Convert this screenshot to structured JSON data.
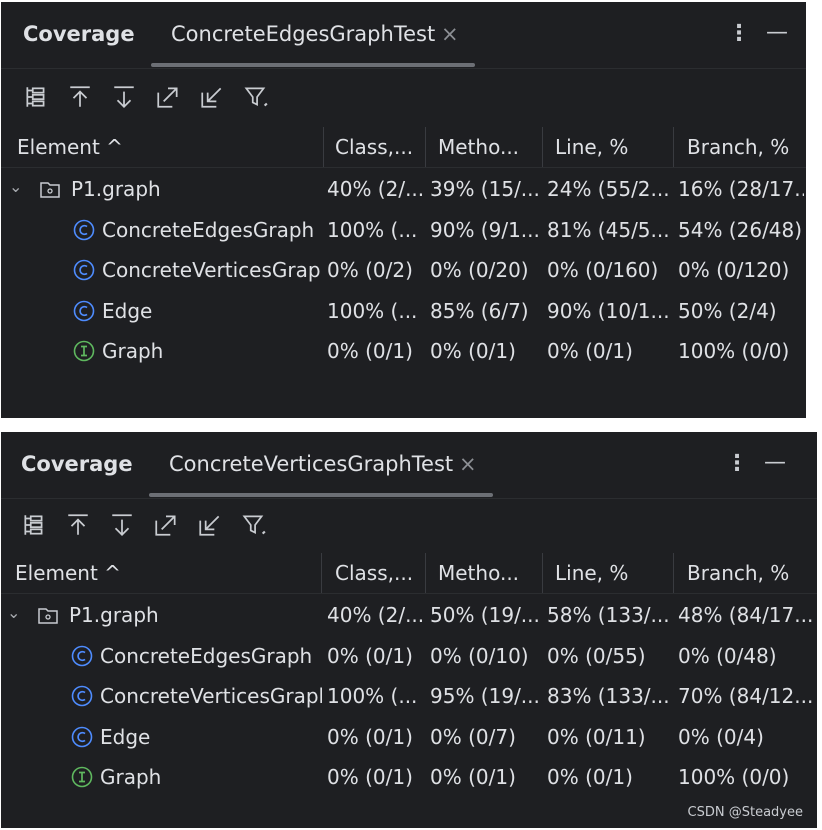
{
  "panels": [
    {
      "title": "Coverage",
      "tab_label": "ConcreteEdgesGraphTest",
      "tab_close": "×",
      "more": "⋮",
      "minimize": "—",
      "columns": [
        "Element",
        "Class,...",
        "Metho...",
        "Line, %",
        "Branch, %"
      ],
      "sort_indicator": "^",
      "rows": [
        {
          "name": "P1.graph",
          "icon": "package-icon",
          "expander": "chevron-down-icon",
          "class": "40% (2/...",
          "method": "39% (15/...",
          "line": "24% (55/2...",
          "branch": "16% (28/17..."
        },
        {
          "name": "ConcreteEdgesGraph",
          "icon": "class-icon",
          "class": "100% (...",
          "method": "90% (9/1...",
          "line": "81% (45/5...",
          "branch": "54% (26/48)"
        },
        {
          "name": "ConcreteVerticesGrap",
          "icon": "class-icon",
          "class": "0% (0/2)",
          "method": "0% (0/20)",
          "line": "0% (0/160)",
          "branch": "0% (0/120)"
        },
        {
          "name": "Edge",
          "icon": "class-icon",
          "class": "100% (...",
          "method": "85% (6/7)",
          "line": "90% (10/1...",
          "branch": "50% (2/4)"
        },
        {
          "name": "Graph",
          "icon": "interface-icon",
          "class": "0% (0/1)",
          "method": "0% (0/1)",
          "line": "0% (0/1)",
          "branch": "100% (0/0)"
        }
      ]
    },
    {
      "title": "Coverage",
      "tab_label": "ConcreteVerticesGraphTest",
      "tab_close": "×",
      "more": "⋮",
      "minimize": "—",
      "columns": [
        "Element",
        "Class,...",
        "Metho...",
        "Line, %",
        "Branch, %"
      ],
      "sort_indicator": "^",
      "rows": [
        {
          "name": "P1.graph",
          "icon": "package-icon",
          "expander": "chevron-down-icon",
          "class": "40% (2/...",
          "method": "50% (19/...",
          "line": "58% (133/...",
          "branch": "48% (84/17..."
        },
        {
          "name": "ConcreteEdgesGraph",
          "icon": "class-icon",
          "class": "0% (0/1)",
          "method": "0% (0/10)",
          "line": "0% (0/55)",
          "branch": "0% (0/48)"
        },
        {
          "name": "ConcreteVerticesGrapl",
          "icon": "class-icon",
          "class": "100% (...",
          "method": "95% (19/...",
          "line": "83% (133/...",
          "branch": "70% (84/12..."
        },
        {
          "name": "Edge",
          "icon": "class-icon",
          "class": "0% (0/1)",
          "method": "0% (0/7)",
          "line": "0% (0/11)",
          "branch": "0% (0/4)"
        },
        {
          "name": "Graph",
          "icon": "interface-icon",
          "class": "0% (0/1)",
          "method": "0% (0/1)",
          "line": "0% (0/1)",
          "branch": "100% (0/0)"
        }
      ]
    }
  ],
  "toolbar_icons": [
    "tree-flatten-icon",
    "arrow-up-to-top-icon",
    "arrow-down-to-bottom-icon",
    "expand-out-icon",
    "collapse-in-icon",
    "filter-icon"
  ],
  "watermark": "CSDN @Steadyee",
  "colors": {
    "panel_bg": "#1e1f22",
    "text": "#dfe1e5",
    "class_icon": "#4e8cff",
    "interface_icon": "#5fb85f"
  }
}
